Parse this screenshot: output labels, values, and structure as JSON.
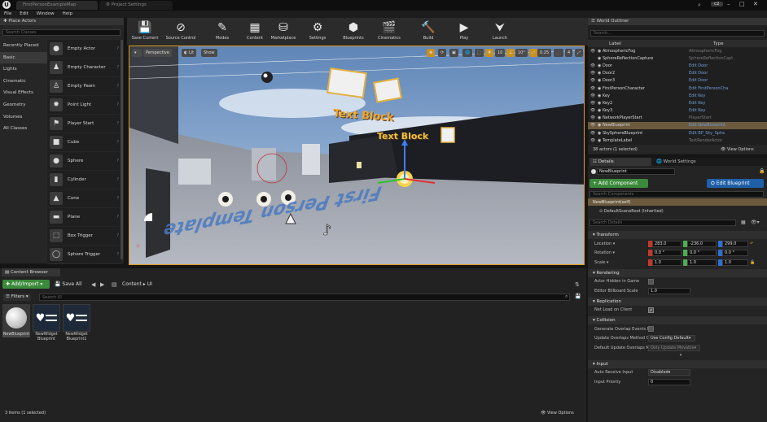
{
  "titlebar": {
    "tabs": [
      "FirstPersonExampleMap",
      "Project Settings"
    ],
    "badge": "c2"
  },
  "menu": [
    "File",
    "Edit",
    "Window",
    "Help"
  ],
  "place_actors": {
    "title": "Place Actors",
    "search_placeholder": "Search Classes",
    "categories": [
      "Recently Placed",
      "Basic",
      "Lights",
      "Cinematic",
      "Visual Effects",
      "Geometry",
      "Volumes",
      "All Classes"
    ],
    "selected_category": "Basic",
    "items": [
      {
        "label": "Empty Actor",
        "icon": "sphere-small-icon"
      },
      {
        "label": "Empty Character",
        "icon": "character-icon"
      },
      {
        "label": "Empty Pawn",
        "icon": "pawn-icon"
      },
      {
        "label": "Point Light",
        "icon": "lightbulb-icon"
      },
      {
        "label": "Player Start",
        "icon": "flag-icon"
      },
      {
        "label": "Cube",
        "icon": "cube-icon"
      },
      {
        "label": "Sphere",
        "icon": "sphere-icon"
      },
      {
        "label": "Cylinder",
        "icon": "cylinder-icon"
      },
      {
        "label": "Cone",
        "icon": "cone-icon"
      },
      {
        "label": "Plane",
        "icon": "plane-icon"
      },
      {
        "label": "Box Trigger",
        "icon": "box-trigger-icon"
      },
      {
        "label": "Sphere Trigger",
        "icon": "sphere-trigger-icon"
      }
    ]
  },
  "toolbar": [
    {
      "label": "Save Current",
      "glyph": "💾"
    },
    {
      "label": "Source Control",
      "glyph": "⊘"
    },
    {
      "label": "Modes",
      "glyph": "✎"
    },
    {
      "label": "Content",
      "glyph": "▦"
    },
    {
      "label": "Marketplace",
      "glyph": "⛁"
    },
    {
      "label": "Settings",
      "glyph": "⚙"
    },
    {
      "label": "Blueprints",
      "glyph": "⬢"
    },
    {
      "label": "Cinematics",
      "glyph": "🎬"
    },
    {
      "label": "Build",
      "glyph": "🔨"
    },
    {
      "label": "Play",
      "glyph": "▶"
    },
    {
      "label": "Launch",
      "glyph": "⮟"
    }
  ],
  "viewport": {
    "perspective": "Perspective",
    "lit": "Lit",
    "show": "Show",
    "grid_snap": "10",
    "rot_snap": "10°",
    "scale_snap": "0.25",
    "cam_speed": "4",
    "layer": "1",
    "text_blocks": [
      "Text Block",
      "Text Block"
    ],
    "floor_text": "First Person Template"
  },
  "outliner": {
    "title": "World Outliner",
    "search_placeholder": "Search...",
    "col_label": "Label",
    "col_type": "Type",
    "rows": [
      {
        "name": "AtmosphericFog",
        "type": "AtmosphericFog",
        "link": false,
        "eye": true
      },
      {
        "name": "SphereReflectionCapture",
        "type": "SphereReflectionCapt",
        "link": false,
        "eye": false
      },
      {
        "name": "Door",
        "type": "Edit Door",
        "link": true,
        "eye": true
      },
      {
        "name": "Door2",
        "type": "Edit Door",
        "link": true,
        "eye": true
      },
      {
        "name": "Door3",
        "type": "Edit Door",
        "link": true,
        "eye": true
      },
      {
        "name": "FirstPersonCharacter",
        "type": "Edit FirstPersonCha",
        "link": true,
        "eye": true
      },
      {
        "name": "Key",
        "type": "Edit Key",
        "link": true,
        "eye": true
      },
      {
        "name": "Key2",
        "type": "Edit Key",
        "link": true,
        "eye": true
      },
      {
        "name": "Key3",
        "type": "Edit Key",
        "link": true,
        "eye": true
      },
      {
        "name": "NetworkPlayerStart",
        "type": "PlayerStart",
        "link": false,
        "eye": true
      },
      {
        "name": "NewBlueprint",
        "type": "Edit NewBlueprint",
        "link": true,
        "eye": true,
        "selected": true
      },
      {
        "name": "SkySphereBlueprint",
        "type": "Edit BP_Sky_Sphe",
        "link": true,
        "eye": true
      },
      {
        "name": "TemplateLabel",
        "type": "TextRenderActor",
        "link": false,
        "eye": true
      }
    ],
    "footer": "38 actors (1 selected)",
    "view_options": "View Options"
  },
  "details": {
    "tabs": [
      "Details",
      "World Settings"
    ],
    "name_value": "NewBlueprint",
    "add_component": "+ Add Component",
    "edit_blueprint": "Edit Blueprint",
    "search_components": "Search Components",
    "components": [
      "NewBlueprint(self)",
      "DefaultSceneRoot (Inherited)"
    ],
    "search_details": "Search Details",
    "sections": {
      "transform": "Transform",
      "rendering": "Rendering",
      "replication": "Replication",
      "collision": "Collision",
      "input": "Input"
    },
    "location": {
      "label": "Location",
      "x": "283.0",
      "y": "-236.0",
      "z": "299.0"
    },
    "rotation": {
      "label": "Rotation",
      "x": "0.0 °",
      "y": "0.0 °",
      "z": "0.0 °"
    },
    "scale": {
      "label": "Scale",
      "x": "1.0",
      "y": "1.0",
      "z": "1.0"
    },
    "actor_hidden": "Actor Hidden in Game",
    "billboard_scale": {
      "label": "Editor Billboard Scale",
      "value": "1.0"
    },
    "net_load": "Net Load on Client",
    "gen_overlap": "Generate Overlap Events D",
    "update_overlap": {
      "label": "Update Overlaps Method D",
      "value": "Use Config Default"
    },
    "default_update": {
      "label": "Default Update Overlaps M",
      "value": "Only Update Movable"
    },
    "auto_receive": {
      "label": "Auto Receive Input",
      "value": "Disabled"
    },
    "input_priority": {
      "label": "Input Priority",
      "value": "0"
    }
  },
  "content_browser": {
    "title": "Content Browser",
    "add_import": "Add/Import",
    "save_all": "Save All",
    "path": [
      "Content",
      "UI"
    ],
    "filters": "Filters",
    "search_placeholder": "Search UI",
    "assets": [
      {
        "label": "NewBlueprint",
        "kind": "sphere"
      },
      {
        "label": "NewWidget Blueprint",
        "kind": "widget"
      },
      {
        "label": "NewWidget Blueprint1",
        "kind": "widget"
      }
    ],
    "footer": "3 items (1 selected)",
    "view_options": "View Options"
  }
}
